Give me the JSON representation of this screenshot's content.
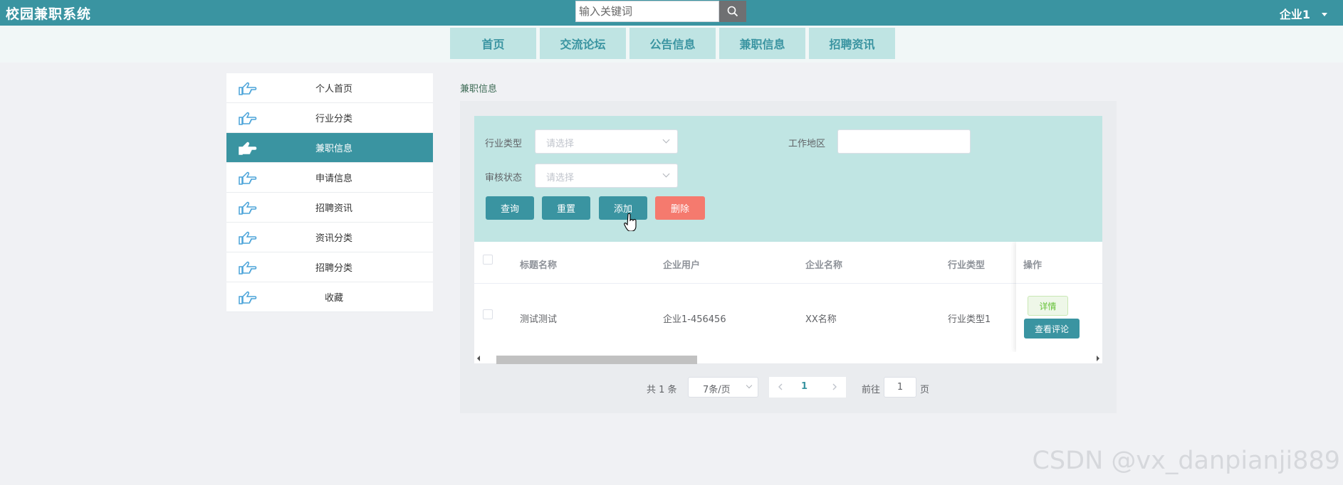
{
  "header": {
    "brand": "校园兼职系统",
    "search_placeholder": "输入关键词",
    "user_label": "企业1"
  },
  "nav": {
    "tabs": [
      {
        "label": "首页"
      },
      {
        "label": "交流论坛"
      },
      {
        "label": "公告信息"
      },
      {
        "label": "兼职信息"
      },
      {
        "label": "招聘资讯"
      }
    ]
  },
  "sidebar": {
    "items": [
      {
        "label": "个人首页",
        "active": false
      },
      {
        "label": "行业分类",
        "active": false
      },
      {
        "label": "兼职信息",
        "active": true
      },
      {
        "label": "申请信息",
        "active": false
      },
      {
        "label": "招聘资讯",
        "active": false
      },
      {
        "label": "资讯分类",
        "active": false
      },
      {
        "label": "招聘分类",
        "active": false
      },
      {
        "label": "收藏",
        "active": false
      }
    ]
  },
  "breadcrumb": "兼职信息",
  "filters": {
    "industry_label": "行业类型",
    "industry_placeholder": "请选择",
    "region_label": "工作地区",
    "region_value": "",
    "audit_label": "审核状态",
    "audit_placeholder": "请选择"
  },
  "actions": {
    "query": "查询",
    "reset": "重置",
    "add": "添加",
    "delete": "删除"
  },
  "table": {
    "columns": [
      "标题名称",
      "企业用户",
      "企业名称",
      "行业类型",
      "操作"
    ],
    "rows": [
      {
        "title": "测试测试",
        "user": "企业1-456456",
        "company": "XX名称",
        "industry": "行业类型1"
      }
    ],
    "detail_label": "详情",
    "review_label": "查看评论",
    "scroll_position": 0
  },
  "pagination": {
    "total": "共 1 条",
    "page_size": "7条/页",
    "current_page": "1",
    "goto_prefix": "前往",
    "goto_value": "1",
    "goto_suffix": "页"
  },
  "watermark": "CSDN @vx_danpianji889",
  "colors": {
    "primary": "#3a94a1",
    "tab_bg": "#bfe4e3",
    "filter_bg": "#c0e5e3",
    "danger": "#f57a6e",
    "success": "#67c23a"
  }
}
